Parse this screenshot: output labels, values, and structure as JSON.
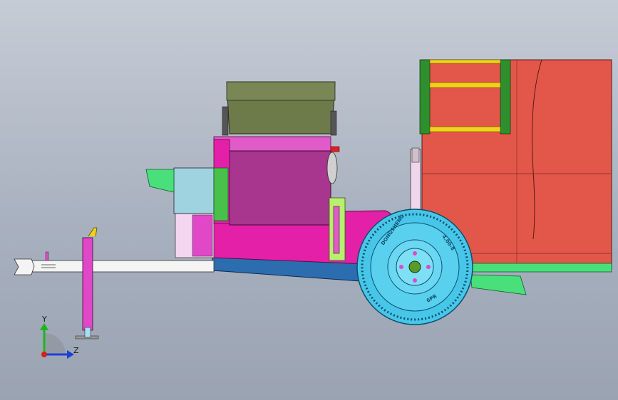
{
  "view": {
    "background_top": "#c6ccd6",
    "background_bottom": "#9aa3b1"
  },
  "triad": {
    "y_label": "Y",
    "z_label": "Z",
    "y_color": "#1fb51f",
    "z_color": "#1f3fd6",
    "origin_color": "#d61f1f"
  },
  "tire": {
    "sidewall_text_left": "DONGSHENG",
    "sidewall_text_right": "4.00-8",
    "sidewall_text_bottom": "6PR",
    "color": "#47c6e8"
  },
  "colors": {
    "tank_body": "#e2574a",
    "tank_frame": "#2f8f2f",
    "tank_stripe": "#f1d21b",
    "hopper": "#6d7a4a",
    "engine_top": "#e05ac8",
    "engine_side": "#a8358e",
    "chassis_blue": "#2c6db0",
    "drawbar": "#f4f4f4",
    "jack": "#e048c8",
    "fender": "#49e07c",
    "light_blue": "#9fd3e0"
  }
}
